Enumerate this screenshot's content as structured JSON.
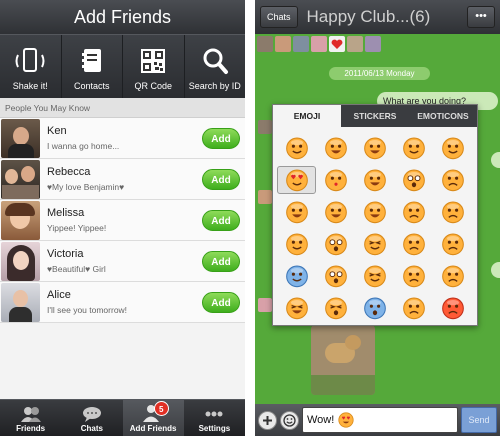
{
  "left": {
    "title": "Add Friends",
    "shortcuts": [
      {
        "label": "Shake it!",
        "icon": "shake-phone-icon"
      },
      {
        "label": "Contacts",
        "icon": "contacts-book-icon"
      },
      {
        "label": "QR Code",
        "icon": "qr-code-icon"
      },
      {
        "label": "Search by ID",
        "icon": "search-icon"
      }
    ],
    "section_label": "People You May Know",
    "friends": [
      {
        "name": "Ken",
        "status": "I wanna go home...",
        "add_label": "Add"
      },
      {
        "name": "Rebecca",
        "status": "♥My love Benjamin♥",
        "add_label": "Add"
      },
      {
        "name": "Melissa",
        "status": "Yippee! Yippee!",
        "add_label": "Add"
      },
      {
        "name": "Victoria",
        "status": "♥Beautiful♥ Girl",
        "add_label": "Add"
      },
      {
        "name": "Alice",
        "status": "I'll see you tomorrow!",
        "add_label": "Add"
      }
    ],
    "tabs": [
      {
        "label": "Friends",
        "icon": "friends-icon"
      },
      {
        "label": "Chats",
        "icon": "chat-bubble-icon"
      },
      {
        "label": "Add Friends",
        "icon": "add-friend-icon",
        "badge": "5"
      },
      {
        "label": "Settings",
        "icon": "more-dots-icon"
      }
    ]
  },
  "right": {
    "back_label": "Chats",
    "title": "Happy Club...(6)",
    "menu_label": "•••",
    "date": "2011/06/13 Monday",
    "partial_bubble": "What are you doing?",
    "panel_tabs": [
      "EMOJI",
      "STICKERS",
      "EMOTICONS"
    ],
    "input_value": "Wow!",
    "send_label": "Send"
  },
  "colors": {
    "header_dark": "#2f3135",
    "add_green": "#3fae1d",
    "chat_green": "#55a93a",
    "badge_red": "#e12f24",
    "send_blue": "#7aa0d6"
  }
}
